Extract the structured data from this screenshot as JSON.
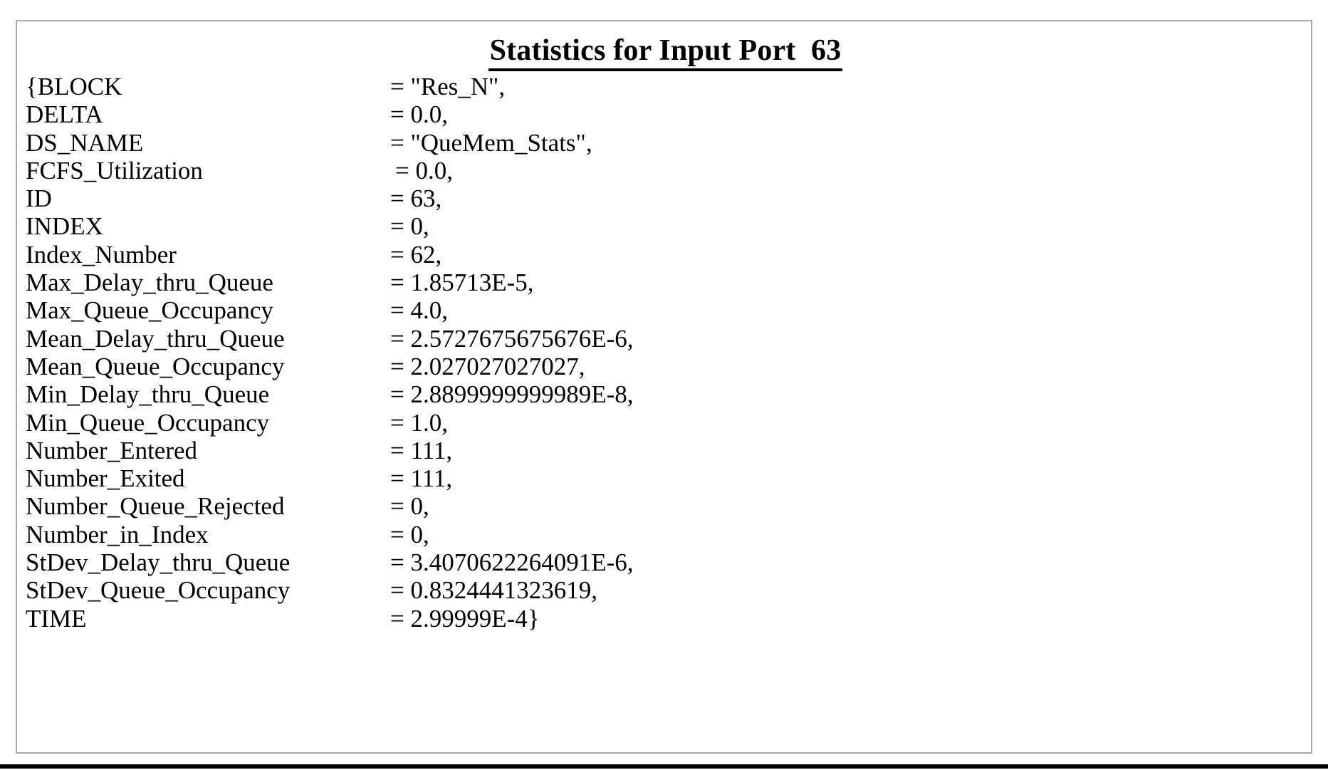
{
  "document": {
    "title": "Statistics for Input Port  63",
    "open_brace": "{",
    "close_brace": "}"
  },
  "stats": {
    "rows": [
      {
        "key": "{BLOCK",
        "value": "= \"Res_N\",",
        "indented": false
      },
      {
        "key": "DELTA",
        "value": "= 0.0,",
        "indented": false
      },
      {
        "key": "DS_NAME",
        "value": "= \"QueMem_Stats\",",
        "indented": false
      },
      {
        "key": "FCFS_Utilization",
        "value": "= 0.0,",
        "indented": true
      },
      {
        "key": "ID",
        "value": "= 63,",
        "indented": false
      },
      {
        "key": "INDEX",
        "value": "= 0,",
        "indented": false
      },
      {
        "key": "Index_Number",
        "value": "= 62,",
        "indented": false
      },
      {
        "key": "Max_Delay_thru_Queue",
        "value": "= 1.85713E-5,",
        "indented": false
      },
      {
        "key": "Max_Queue_Occupancy",
        "value": "= 4.0,",
        "indented": false
      },
      {
        "key": "Mean_Delay_thru_Queue",
        "value": "= 2.5727675675676E-6,",
        "indented": false
      },
      {
        "key": "Mean_Queue_Occupancy",
        "value": "= 2.027027027027,",
        "indented": false
      },
      {
        "key": "Min_Delay_thru_Queue",
        "value": "= 2.8899999999989E-8,",
        "indented": false
      },
      {
        "key": "Min_Queue_Occupancy",
        "value": "= 1.0,",
        "indented": false
      },
      {
        "key": "Number_Entered",
        "value": "= 111,",
        "indented": false
      },
      {
        "key": "Number_Exited",
        "value": "= 111,",
        "indented": false
      },
      {
        "key": "Number_Queue_Rejected",
        "value": "= 0,",
        "indented": false
      },
      {
        "key": "Number_in_Index",
        "value": "= 0,",
        "indented": false
      },
      {
        "key": "StDev_Delay_thru_Queue",
        "value": "= 3.4070622264091E-6,",
        "indented": false
      },
      {
        "key": "StDev_Queue_Occupancy",
        "value": "= 0.8324441323619,",
        "indented": false
      },
      {
        "key": "TIME",
        "value": "= 2.99999E-4}",
        "indented": false
      }
    ]
  },
  "colors": {
    "text": "#000000",
    "panel_border": "#a8a8a8",
    "page_background": "#ffffff",
    "bottom_rule": "#000000"
  }
}
